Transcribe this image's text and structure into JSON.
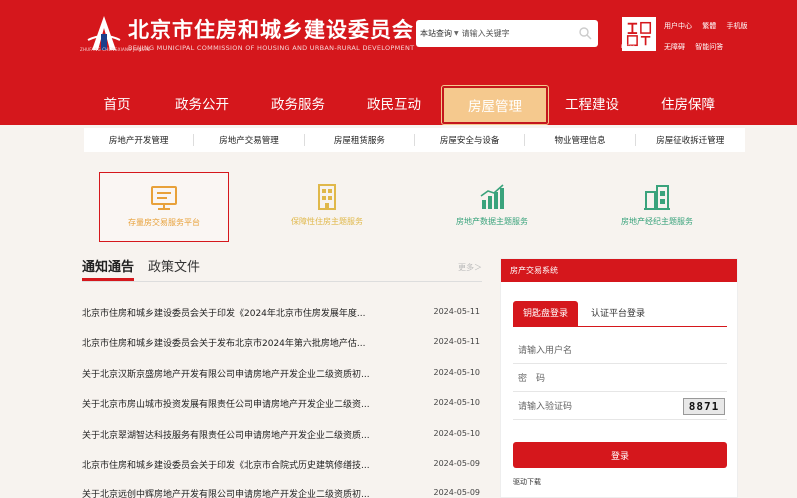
{
  "header": {
    "title": "北京市住房和城乡建设委员会",
    "subtitle": "BEIJING MUNICIPAL COMMISSION OF HOUSING AND URBAN-RURAL DEVELOPMENT",
    "logo_caption": "ZHUFANG CHENGXIANG JIANSHE",
    "emblem_caption": "Beijing",
    "top_links_row1": [
      "用户中心",
      "繁體",
      "手机版"
    ],
    "top_links_row2": [
      "无障碍",
      "智能问答"
    ],
    "accent_color": "#d5171c"
  },
  "search": {
    "scope": "本站查询",
    "placeholder": "请输入关键字"
  },
  "nav": {
    "items": [
      "首页",
      "政务公开",
      "政务服务",
      "政民互动",
      "房屋管理",
      "工程建设",
      "住房保障"
    ],
    "active": "房屋管理"
  },
  "subnav": {
    "items": [
      "房地产开发管理",
      "房地产交易管理",
      "房屋租赁服务",
      "房屋安全与设备",
      "物业管理信息",
      "房屋征收拆迁管理"
    ]
  },
  "services": [
    {
      "label": "存量房交易服务平台",
      "icon": "monitor-icon",
      "color": "#e8a13a"
    },
    {
      "label": "保障性住房主题服务",
      "icon": "building-icon",
      "color": "#e0b84a"
    },
    {
      "label": "房地产数据主题服务",
      "icon": "chart-icon",
      "color": "#3aa37c"
    },
    {
      "label": "房地产经纪主题服务",
      "icon": "houses-icon",
      "color": "#3aa37c"
    }
  ],
  "notices": {
    "tabs": [
      "通知通告",
      "政策文件"
    ],
    "more": "更多＞",
    "rows": [
      {
        "title": "北京市住房和城乡建设委员会关于印发《2024年北京市住房发展年度...",
        "date": "2024-05-11"
      },
      {
        "title": "北京市住房和城乡建设委员会关于发布北京市2024年第六批房地产估...",
        "date": "2024-05-11"
      },
      {
        "title": "关于北京汉斯京盛房地产开发有限公司申请房地产开发企业二级资质初...",
        "date": "2024-05-10"
      },
      {
        "title": "关于北京市房山城市投资发展有限责任公司申请房地产开发企业二级资...",
        "date": "2024-05-10"
      },
      {
        "title": "关于北京翠湖智达科技服务有限责任公司申请房地产开发企业二级资质...",
        "date": "2024-05-10"
      },
      {
        "title": "北京市住房和城乡建设委员会关于印发《北京市合院式历史建筑修缮技...",
        "date": "2024-05-09"
      },
      {
        "title": "关于北京远创中辉房地产开发有限公司申请房地产开发企业二级资质初...",
        "date": "2024-05-09"
      }
    ]
  },
  "login": {
    "panel_title": "房产交易系统",
    "tabs": [
      "钥匙盘登录",
      "认证平台登录"
    ],
    "username_placeholder": "请输入用户名",
    "password_placeholder": "密　码",
    "captcha_placeholder": "请输入验证码",
    "captcha_text": "8871",
    "button_label": "登录",
    "driver_link": "驱动下载"
  }
}
